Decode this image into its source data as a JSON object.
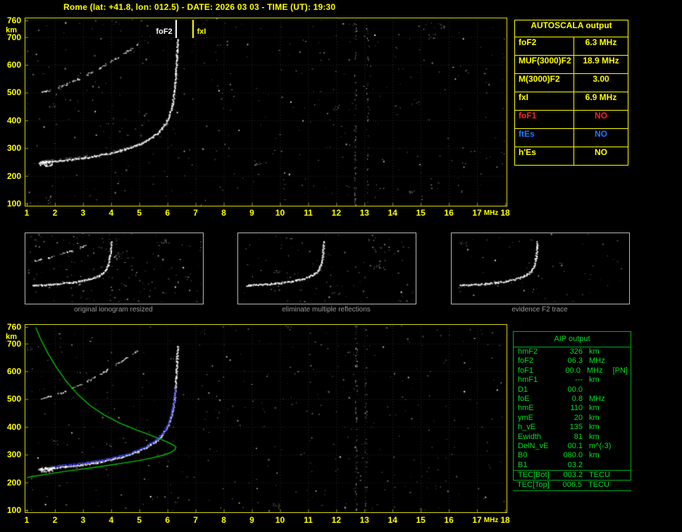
{
  "title": "Rome (lat: +41.8, lon: 012.5) - DATE: 2026 03 03 - TIME (UT): 19:30",
  "autoscala_table": {
    "title": "AUTOSCALA output",
    "rows": [
      {
        "label": "foF2",
        "value": "6.3 MHz",
        "color": "#ffff00"
      },
      {
        "label": "MUF(3000)F2",
        "value": "18.9 MHz",
        "color": "#ffff00"
      },
      {
        "label": "M(3000)F2",
        "value": "3.00",
        "color": "#ffff00"
      },
      {
        "label": "fxI",
        "value": "6.9 MHz",
        "color": "#ffff00"
      },
      {
        "label": "foF1",
        "value": "NO",
        "color": "#ff2222"
      },
      {
        "label": "ftEs",
        "value": "NO",
        "color": "#2277ff"
      },
      {
        "label": "h'Es",
        "value": "NO",
        "color": "#ffff00"
      }
    ]
  },
  "aip_table": {
    "title": "AIP output",
    "rows": [
      {
        "label": "hmF2",
        "value": "326",
        "unit": "km",
        "extra": ""
      },
      {
        "label": "foF2",
        "value": "06.3",
        "unit": "MHz",
        "extra": ""
      },
      {
        "label": "foF1",
        "value": "00.0",
        "unit": "MHz",
        "extra": "[PN]"
      },
      {
        "label": "hmF1",
        "value": "---",
        "unit": "km",
        "extra": ""
      },
      {
        "label": "D1",
        "value": "00.0",
        "unit": "",
        "extra": ""
      },
      {
        "label": "foE",
        "value": "0.8",
        "unit": "MHz",
        "extra": ""
      },
      {
        "label": "hmE",
        "value": "110",
        "unit": "km",
        "extra": ""
      },
      {
        "label": "ymE",
        "value": "20",
        "unit": "km",
        "extra": ""
      },
      {
        "label": "h_vE",
        "value": "135",
        "unit": "km",
        "extra": ""
      },
      {
        "label": "Ewidth",
        "value": "81",
        "unit": "km",
        "extra": ""
      },
      {
        "label": "DelN_vE",
        "value": "00.1",
        "unit": "m^(-3)",
        "extra": ""
      },
      {
        "label": "B0",
        "value": "080.0",
        "unit": "km",
        "extra": ""
      },
      {
        "label": "B1",
        "value": "03.2",
        "unit": "",
        "extra": ""
      },
      {
        "label": "TEC[Bot]",
        "value": "003.2",
        "unit": "TECU",
        "extra": ""
      },
      {
        "label": "TEC[Top]",
        "value": "006.5",
        "unit": "TECU",
        "extra": ""
      }
    ]
  },
  "thumbnails": [
    {
      "caption": "original ionogram resized",
      "xlim": [
        1,
        12
      ],
      "show_hop": true,
      "noise": 170
    },
    {
      "caption": "eliminate multiple reflections",
      "xlim": [
        1,
        12
      ],
      "show_hop": false,
      "noise": 110
    },
    {
      "caption": "evidence F2 trace",
      "xlim": [
        1,
        12
      ],
      "show_hop": false,
      "noise": 55
    }
  ],
  "chart_data": [
    {
      "name": "scaled_ionogram",
      "type": "scatter",
      "xlabel": "MHz",
      "ylabel": "km",
      "xlim": [
        1,
        18
      ],
      "ylim": [
        100,
        760
      ],
      "xticks": [
        1,
        2,
        3,
        4,
        5,
        6,
        7,
        8,
        9,
        10,
        11,
        12,
        13,
        14,
        15,
        16,
        17,
        18
      ],
      "yticks": [
        100,
        200,
        300,
        400,
        500,
        600,
        700,
        760
      ],
      "grid": true,
      "markers": [
        {
          "label": "foF2",
          "freq": 6.3,
          "color": "#ffffff",
          "label_side": "left"
        },
        {
          "label": "fxI",
          "freq": 6.9,
          "color": "#ffff00",
          "label_side": "right"
        }
      ],
      "f2_trace": [
        [
          1.45,
          246
        ],
        [
          1.7,
          249
        ],
        [
          2.0,
          252
        ],
        [
          2.3,
          255
        ],
        [
          2.6,
          258
        ],
        [
          2.9,
          262
        ],
        [
          3.2,
          266
        ],
        [
          3.5,
          271
        ],
        [
          3.8,
          277
        ],
        [
          4.1,
          284
        ],
        [
          4.4,
          292
        ],
        [
          4.7,
          301
        ],
        [
          5.0,
          312
        ],
        [
          5.25,
          325
        ],
        [
          5.5,
          340
        ],
        [
          5.7,
          356
        ],
        [
          5.85,
          373
        ],
        [
          5.97,
          392
        ],
        [
          6.07,
          414
        ],
        [
          6.14,
          438
        ],
        [
          6.2,
          465
        ],
        [
          6.25,
          497
        ],
        [
          6.28,
          532
        ],
        [
          6.31,
          570
        ],
        [
          6.33,
          610
        ],
        [
          6.35,
          650
        ],
        [
          6.37,
          690
        ]
      ],
      "echo_offset_km": 10,
      "second_hop": [
        [
          1.55,
          500
        ],
        [
          1.9,
          510
        ],
        [
          2.3,
          524
        ],
        [
          2.7,
          541
        ],
        [
          3.1,
          560
        ],
        [
          3.5,
          582
        ],
        [
          3.9,
          606
        ],
        [
          4.3,
          630
        ],
        [
          4.65,
          652
        ],
        [
          4.95,
          672
        ]
      ],
      "interference": [
        {
          "freq": 12.67,
          "count": 90
        },
        {
          "freq": 13.1,
          "count": 40
        }
      ],
      "noise_points": 420
    },
    {
      "name": "profile_ionogram",
      "type": "scatter",
      "xlabel": "MHz",
      "ylabel": "km",
      "xlim": [
        1,
        18
      ],
      "ylim": [
        100,
        760
      ],
      "xticks": [
        1,
        2,
        3,
        4,
        5,
        6,
        7,
        8,
        9,
        10,
        11,
        12,
        13,
        14,
        15,
        16,
        17,
        18
      ],
      "yticks": [
        100,
        200,
        300,
        400,
        500,
        600,
        700,
        760
      ],
      "grid": true,
      "f2_trace": [
        [
          1.45,
          246
        ],
        [
          1.7,
          249
        ],
        [
          2.0,
          252
        ],
        [
          2.3,
          255
        ],
        [
          2.6,
          258
        ],
        [
          2.9,
          262
        ],
        [
          3.2,
          266
        ],
        [
          3.5,
          271
        ],
        [
          3.8,
          277
        ],
        [
          4.1,
          284
        ],
        [
          4.4,
          292
        ],
        [
          4.7,
          301
        ],
        [
          5.0,
          312
        ],
        [
          5.25,
          325
        ],
        [
          5.5,
          340
        ],
        [
          5.7,
          356
        ],
        [
          5.85,
          373
        ],
        [
          5.97,
          392
        ],
        [
          6.07,
          414
        ],
        [
          6.14,
          438
        ],
        [
          6.2,
          465
        ],
        [
          6.25,
          497
        ],
        [
          6.28,
          532
        ],
        [
          6.31,
          570
        ],
        [
          6.33,
          610
        ],
        [
          6.35,
          650
        ],
        [
          6.37,
          690
        ]
      ],
      "echo_offset_km": 10,
      "second_hop": [
        [
          1.55,
          500
        ],
        [
          1.9,
          510
        ],
        [
          2.3,
          524
        ],
        [
          2.7,
          541
        ],
        [
          3.1,
          560
        ],
        [
          3.5,
          582
        ],
        [
          3.9,
          606
        ],
        [
          4.3,
          630
        ],
        [
          4.65,
          652
        ],
        [
          4.95,
          672
        ]
      ],
      "profile": [
        [
          1.32,
          758
        ],
        [
          1.5,
          715
        ],
        [
          1.75,
          665
        ],
        [
          2.05,
          615
        ],
        [
          2.4,
          565
        ],
        [
          2.8,
          518
        ],
        [
          3.25,
          477
        ],
        [
          3.75,
          443
        ],
        [
          4.3,
          414
        ],
        [
          4.85,
          391
        ],
        [
          5.35,
          372
        ],
        [
          5.75,
          356
        ],
        [
          6.05,
          343
        ],
        [
          6.22,
          334
        ],
        [
          6.3,
          327
        ],
        [
          6.27,
          318
        ],
        [
          6.12,
          308
        ],
        [
          5.85,
          298
        ],
        [
          5.45,
          288
        ],
        [
          4.95,
          278
        ],
        [
          4.4,
          269
        ],
        [
          3.8,
          260
        ],
        [
          3.2,
          251
        ],
        [
          2.6,
          243
        ],
        [
          2.05,
          235
        ],
        [
          1.6,
          228
        ],
        [
          1.25,
          222
        ],
        [
          1.0,
          217
        ]
      ],
      "profile_color": "#00c400",
      "restored_trace": {
        "fmin": 2.0,
        "fmax": 6.32,
        "hmax": 535,
        "color": "#3333e8"
      },
      "interference": [
        {
          "freq": 12.7,
          "count": 85
        },
        {
          "freq": 13.05,
          "count": 45
        }
      ],
      "noise_points": 400
    }
  ]
}
